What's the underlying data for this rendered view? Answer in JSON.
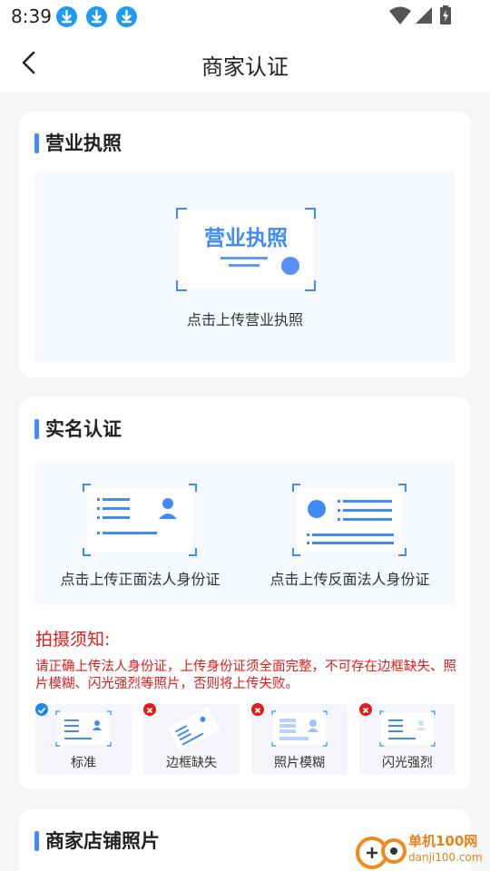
{
  "status_bar": {
    "time": "8:39",
    "notification_icons": [
      "download-icon",
      "download-icon",
      "download-icon"
    ],
    "system_icons": [
      "wifi-icon",
      "signal-icon",
      "battery-charging-icon"
    ]
  },
  "nav": {
    "back_icon": "chevron-left-icon",
    "title": "商家认证"
  },
  "business_license": {
    "title": "营业执照",
    "preview_text": "营业执照",
    "upload_label": "点击上传营业执照"
  },
  "real_name": {
    "title": "实名认证",
    "front_label": "点击上传正面法人身份证",
    "back_label": "点击上传反面法人身份证",
    "notice_title": "拍摄须知:",
    "notice_text": "请正确上传法人身份证，上传身份证须全面完整，不可存在边框缺失、照片模糊、闪光强烈等照片，否则将上传失败。",
    "examples": [
      {
        "label": "标准",
        "status": "ok"
      },
      {
        "label": "边框缺失",
        "status": "bad"
      },
      {
        "label": "照片模糊",
        "status": "bad"
      },
      {
        "label": "闪光强烈",
        "status": "bad"
      }
    ]
  },
  "store_photos": {
    "title": "商家店铺照片"
  },
  "watermark": {
    "site_name": "单机100网",
    "domain": "danji100.com"
  },
  "colors": {
    "accent": "#3f8cf7",
    "warning": "#e21b1b",
    "upload_bg": "#f5f8fd",
    "page_bg": "#f4f5f7"
  }
}
